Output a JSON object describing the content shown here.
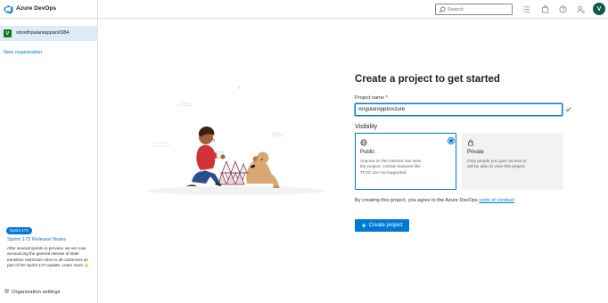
{
  "header": {
    "brand": "Azure DevOps",
    "search": {
      "placeholder": "Search"
    },
    "icons": [
      "list-icon",
      "shopping-bag-icon",
      "help-icon",
      "user-settings-icon"
    ],
    "avatar_initial": "V"
  },
  "sidebar": {
    "organization": {
      "initial": "V",
      "name": "vinodhpalaniappan0384"
    },
    "new_organization": "New organization",
    "sprint": {
      "badge": "Sprint 172",
      "title": "Sprint 172 Release Notes",
      "text": "After several sprints in preview, we are now announcing the general release of state transition restriction rules to all customers as part of the Sprint 172 Update. Learn more 👆"
    },
    "settings_label": "Organization settings"
  },
  "form": {
    "heading": "Create a project to get started",
    "project_name_label": "Project name *",
    "project_name_value": "AngularAppInAzure",
    "visibility_label": "Visibility",
    "options": [
      {
        "title": "Public",
        "description": "Anyone on the internet can view the project. Certain features like TFVC are not supported.",
        "selected": true,
        "icon": "globe-icon"
      },
      {
        "title": "Private",
        "description": "Only people you give access to will be able to view this project.",
        "selected": false,
        "icon": "lock-icon"
      }
    ],
    "agreement_prefix": "By creating this project, you agree to the Azure DevOps",
    "agreement_link": "code of conduct",
    "create_button": "Create project"
  },
  "colors": {
    "accent": "#0078d4",
    "sidebar_selected": "#deecf9",
    "avatar": "#0b5a4a",
    "org_avatar": "#107c10"
  }
}
